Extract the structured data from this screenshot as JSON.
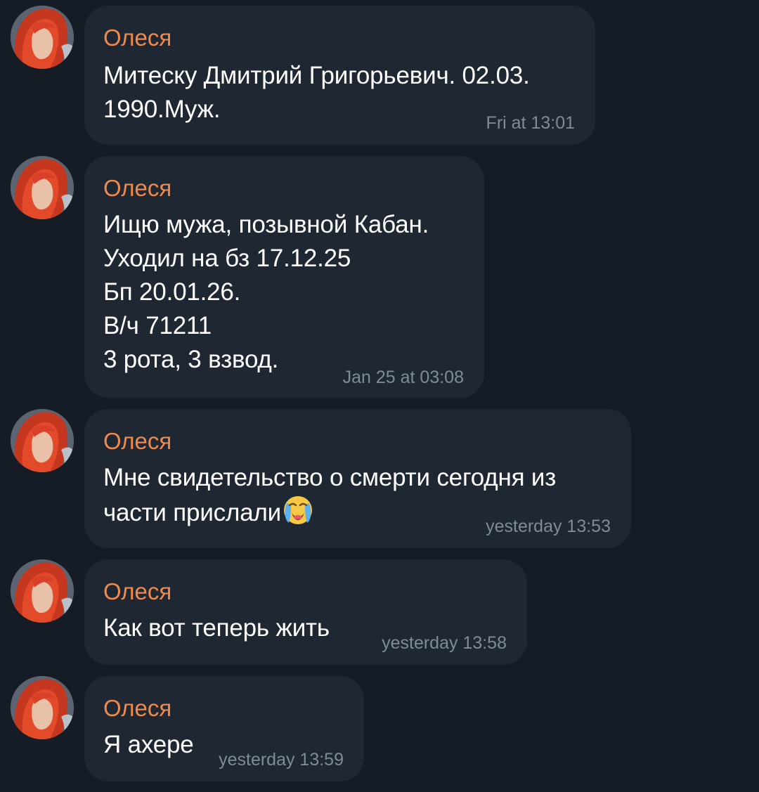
{
  "messages": [
    {
      "sender": "Олеся",
      "text": "Митеску Дмитрий Григорьевич. 02.03.\n1990.Муж.",
      "time": "Fri at 13:01"
    },
    {
      "sender": "Олеся",
      "text": "Ищю мужа, позывной Кабан.\nУходил на бз 17.12.25\nБп 20.01.26.\nВ/ч 71211\n3 рота, 3 взвод.",
      "time": "Jan 25 at 03:08"
    },
    {
      "sender": "Олеся",
      "text_line1": "Мне свидетельство о смерти сегодня из",
      "text_line2": "части прислали",
      "emoji": "loudly-crying-face",
      "time": "yesterday 13:53"
    },
    {
      "sender": "Олеся",
      "text": "Как вот теперь жить",
      "time": "yesterday 13:58"
    },
    {
      "sender": "Олеся",
      "text": "Я ахере",
      "time": "yesterday 13:59"
    }
  ],
  "colors": {
    "background": "#151c25",
    "bubble": "#1f2732",
    "sender_name": "#ef8a4c",
    "message_text": "#ffffff",
    "timestamp": "#7f8b97"
  },
  "icons": {
    "avatar": "avatar-photo-red-hair",
    "emoji": "loudly-crying-face"
  }
}
